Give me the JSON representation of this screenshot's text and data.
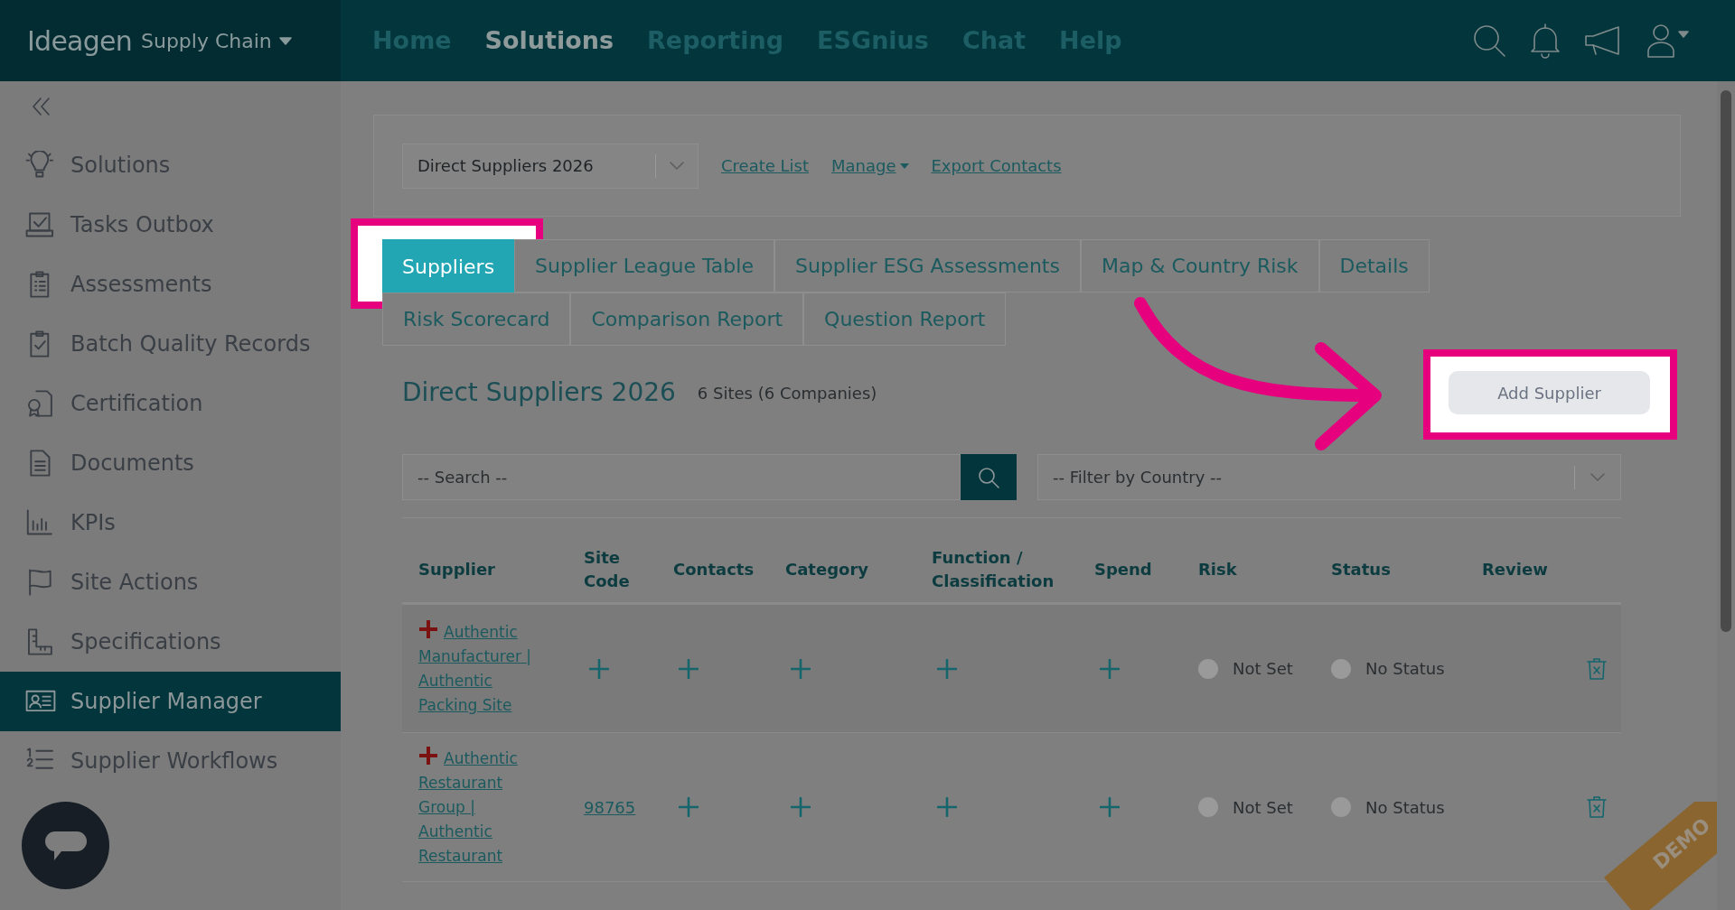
{
  "header": {
    "logo": "Ideagen",
    "product": "Supply Chain",
    "nav": [
      {
        "label": "Home",
        "selected": false
      },
      {
        "label": "Solutions",
        "selected": true
      },
      {
        "label": "Reporting",
        "selected": false
      },
      {
        "label": "ESGnius",
        "selected": false
      },
      {
        "label": "Chat",
        "selected": false
      },
      {
        "label": "Help",
        "selected": false
      }
    ]
  },
  "sidebar": {
    "items": [
      {
        "label": "Solutions",
        "selected": false
      },
      {
        "label": "Tasks Outbox",
        "selected": false
      },
      {
        "label": "Assessments",
        "selected": false
      },
      {
        "label": "Batch Quality Records",
        "selected": false
      },
      {
        "label": "Certification",
        "selected": false
      },
      {
        "label": "Documents",
        "selected": false
      },
      {
        "label": "KPIs",
        "selected": false
      },
      {
        "label": "Site Actions",
        "selected": false
      },
      {
        "label": "Specifications",
        "selected": false
      },
      {
        "label": "Supplier Manager",
        "selected": true
      },
      {
        "label": "Supplier Workflows",
        "selected": false
      }
    ]
  },
  "list_selector": {
    "value": "Direct Suppliers 2026"
  },
  "links": [
    {
      "label": "Create List",
      "kind": "plain"
    },
    {
      "label": "Manage",
      "kind": "menu"
    },
    {
      "label": "Export Contacts",
      "kind": "plain"
    }
  ],
  "tabs": [
    {
      "label": "Suppliers",
      "selected": true,
      "highlighted": true
    },
    {
      "label": "Supplier League Table",
      "selected": false,
      "highlighted": false
    },
    {
      "label": "Supplier ESG Assessments",
      "selected": false,
      "highlighted": false
    },
    {
      "label": "Map & Country Risk",
      "selected": false,
      "highlighted": false
    },
    {
      "label": "Details",
      "selected": false,
      "highlighted": false
    },
    {
      "label": "Risk Scorecard",
      "selected": false,
      "highlighted": false
    },
    {
      "label": "Comparison Report",
      "selected": false,
      "highlighted": false
    },
    {
      "label": "Question Report",
      "selected": false,
      "highlighted": false
    }
  ],
  "list_title": "Direct Suppliers 2026",
  "list_count": "6 Sites (6 Companies)",
  "add_button": {
    "label": "Add Supplier",
    "highlighted": true
  },
  "search": {
    "placeholder": "-- Search --"
  },
  "country_filter": {
    "placeholder": "-- Filter by Country --"
  },
  "table": {
    "columns": [
      "Supplier",
      "Site Code",
      "Contacts",
      "Category",
      "Function / Classification",
      "Spend",
      "Risk",
      "Status",
      "Review"
    ],
    "rows": [
      {
        "supplier": "Authentic Manufacturer | Authentic Packing Site",
        "risk": "Not Set",
        "status": "No Status"
      },
      {
        "supplier": "Authentic Restaurant Group | Authentic Restaurant",
        "site_code": "98765",
        "risk": "Not Set",
        "status": "No Status"
      }
    ]
  },
  "demo_ribbon": "DEMO"
}
